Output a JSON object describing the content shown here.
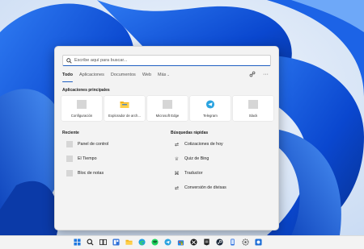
{
  "search": {
    "placeholder": "Escribe aquí para buscar..."
  },
  "tabs": [
    {
      "label": "Todo"
    },
    {
      "label": "Aplicaciones"
    },
    {
      "label": "Documentos"
    },
    {
      "label": "Web"
    },
    {
      "label": "Más"
    }
  ],
  "actions": {
    "share_icon": "share-icon",
    "more_icon": "more-icon",
    "more_glyph": "···"
  },
  "top_apps": {
    "title": "Aplicaciones principales",
    "items": [
      {
        "label": "Configuración",
        "icon": "gray-placeholder-icon"
      },
      {
        "label": "Explorador de arch...",
        "icon": "folder-icon"
      },
      {
        "label": "Microsoft Edge",
        "icon": "gray-placeholder-icon"
      },
      {
        "label": "Telegram",
        "icon": "telegram-icon"
      },
      {
        "label": "Slack",
        "icon": "gray-placeholder-icon"
      }
    ]
  },
  "recent": {
    "title": "Reciente",
    "items": [
      {
        "label": "Panel de control"
      },
      {
        "label": "El Tiempo"
      },
      {
        "label": "Bloc de notas"
      }
    ]
  },
  "quick": {
    "title": "Búsquedas rápidas",
    "items": [
      {
        "label": "Cotizaciones de hoy",
        "icon": "exchange-icon"
      },
      {
        "label": "Quiz de Bing",
        "icon": "trophy-icon"
      },
      {
        "label": "Traductor",
        "icon": "translate-icon"
      },
      {
        "label": "Conversión de divisas",
        "icon": "exchange-icon"
      }
    ]
  },
  "colors": {
    "accent": "#1f5fc2",
    "wallpaper_light": "#dde8f7",
    "wallpaper_blue": "#0b4fd6"
  }
}
